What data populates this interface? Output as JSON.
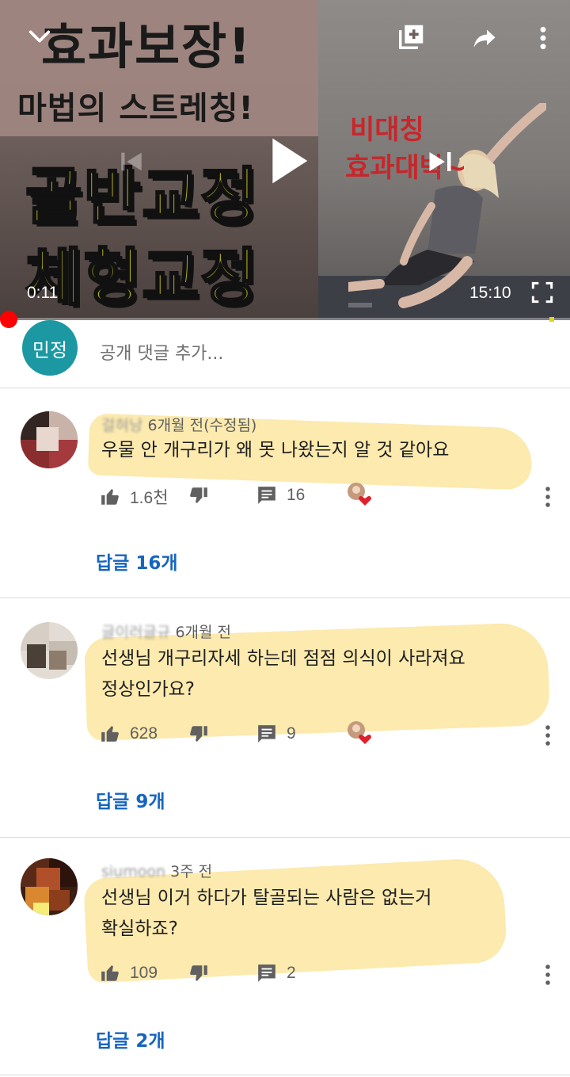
{
  "player": {
    "overlay_title_line1": "효과보장!",
    "overlay_title_line2": "마법의 스트레칭!",
    "overlay_title_line3": "골반교정",
    "overlay_title_line4": "체형교정",
    "side_text_line1": "비대칭",
    "side_text_line2": "효과대박~",
    "current_time": "0:11",
    "duration": "15:10",
    "progress_fraction": 0.012,
    "colors": {
      "progress": "#ff0000",
      "buffer": "#e6d21c"
    },
    "icons": [
      "chevron-down-icon",
      "add-to-playlist-icon",
      "share-icon",
      "more-vert-icon",
      "previous-icon",
      "play-icon",
      "next-icon",
      "fullscreen-icon"
    ]
  },
  "add_comment": {
    "avatar_text": "민정",
    "placeholder": "공개 댓글 추가...",
    "avatar_color": "#1c98a2"
  },
  "comments": [
    {
      "author": "걸혀낭",
      "time": "6개월 전(수정됨)",
      "text_lines": [
        "우물 안 개구리가 왜 못 나왔는지 알 것 같아요"
      ],
      "likes": "1.6천",
      "reply_count": "16",
      "replies_label": "답글 16개"
    },
    {
      "author": "글이러글규",
      "time": "6개월 전",
      "text_lines": [
        "선생님 개구리자세 하는데 점점 의식이 사라져요",
        "정상인가요?"
      ],
      "likes": "628",
      "reply_count": "9",
      "replies_label": "답글 9개"
    },
    {
      "author": "siumoon",
      "time": "3주 전",
      "text_lines": [
        "선생님 이거 하다가 탈골되는 사람은 없는거",
        "확실하죠?"
      ],
      "likes": "109",
      "reply_count": "2",
      "replies_label": "답글 2개"
    }
  ],
  "colors": {
    "link": "#1565c0",
    "highlight": "#fbe6a0",
    "heart": "#e0202a"
  }
}
